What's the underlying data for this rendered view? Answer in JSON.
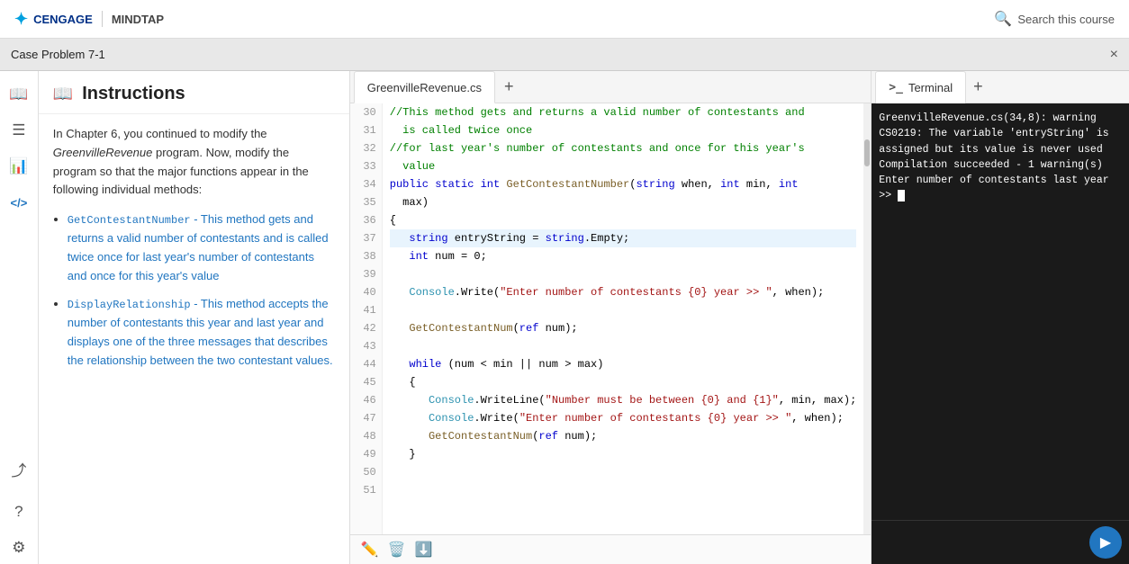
{
  "topbar": {
    "logo_text": "CENGAGE",
    "divider": "|",
    "product_text": "MINDTAP",
    "search_placeholder": "Search this course"
  },
  "window": {
    "title": "Case Problem 7-1",
    "close_label": "×"
  },
  "sidebar": {
    "icons": [
      {
        "name": "book-icon",
        "symbol": "📖"
      },
      {
        "name": "list-icon",
        "symbol": "≡"
      },
      {
        "name": "chart-icon",
        "symbol": "📊"
      },
      {
        "name": "code-icon",
        "symbol": "</>"
      },
      {
        "name": "share-icon",
        "symbol": "⤴"
      },
      {
        "name": "help-icon",
        "symbol": "?"
      },
      {
        "name": "settings-icon",
        "symbol": "⚙"
      }
    ]
  },
  "instructions": {
    "title": "Instructions",
    "body_intro": "In Chapter 6, you continued to modify the ",
    "program_name": "GreenvilleRevenue",
    "body_mid": " program. Now, modify the program so that the major functions appear in the following individual methods:",
    "bullets": [
      {
        "method": "GetContestantNumber",
        "desc": " - This method gets and returns a valid number of contestants and is called twice once for last year's number of contestants and once for this year's value"
      },
      {
        "method": "DisplayRelationship",
        "desc": " - This method accepts the number of contestants this year and last year and displays one of the three messages that describes the relationship between the two contestant values."
      }
    ]
  },
  "editor": {
    "tab_label": "GreenvilleRevenue.cs",
    "add_tab_symbol": "+",
    "lines": [
      {
        "num": 30,
        "content": "//This method gets and returns a valid number of contestants and"
      },
      {
        "num": 31,
        "content": "  is called twice once"
      },
      {
        "num": 32,
        "content": "//for last year's number of contestants and once for this year's"
      },
      {
        "num": 33,
        "content": "  value"
      },
      {
        "num": 34,
        "content": "public static int GetContestantNumber(string when, int min, int"
      },
      {
        "num": 35,
        "content": "  max)"
      },
      {
        "num": 36,
        "content": "{"
      },
      {
        "num": 37,
        "content": "   string entryString = string.Empty;"
      },
      {
        "num": 38,
        "content": "   int num = 0;"
      },
      {
        "num": 39,
        "content": ""
      },
      {
        "num": 40,
        "content": "   Console.Write(\"Enter number of contestants {0} year >> \", when);"
      },
      {
        "num": 41,
        "content": ""
      },
      {
        "num": 42,
        "content": "   GetContestantNum(ref num);"
      },
      {
        "num": 43,
        "content": ""
      },
      {
        "num": 44,
        "content": "   while (num < min || num > max)"
      },
      {
        "num": 45,
        "content": "   {"
      },
      {
        "num": 46,
        "content": "      Console.WriteLine(\"Number must be between {0} and {1}\", min, max);"
      },
      {
        "num": 47,
        "content": "      Console.Write(\"Enter number of contestants {0} year >> \", when);"
      },
      {
        "num": 48,
        "content": "      GetContestantNum(ref num);"
      },
      {
        "num": 49,
        "content": "   }"
      },
      {
        "num": 50,
        "content": ""
      },
      {
        "num": 51,
        "content": ""
      }
    ],
    "toolbar_icons": [
      "pencil",
      "trash",
      "download"
    ]
  },
  "terminal": {
    "tab_label": "Terminal",
    "add_tab_symbol": "+",
    "output": "GreenvilleRevenue.cs(34,8): warning CS0219: The variable 'entryString' is assigned but its value is never used\nCompilation succeeded - 1 warning(s)\nEnter number of contestants last year >> ",
    "play_symbol": "▶"
  }
}
